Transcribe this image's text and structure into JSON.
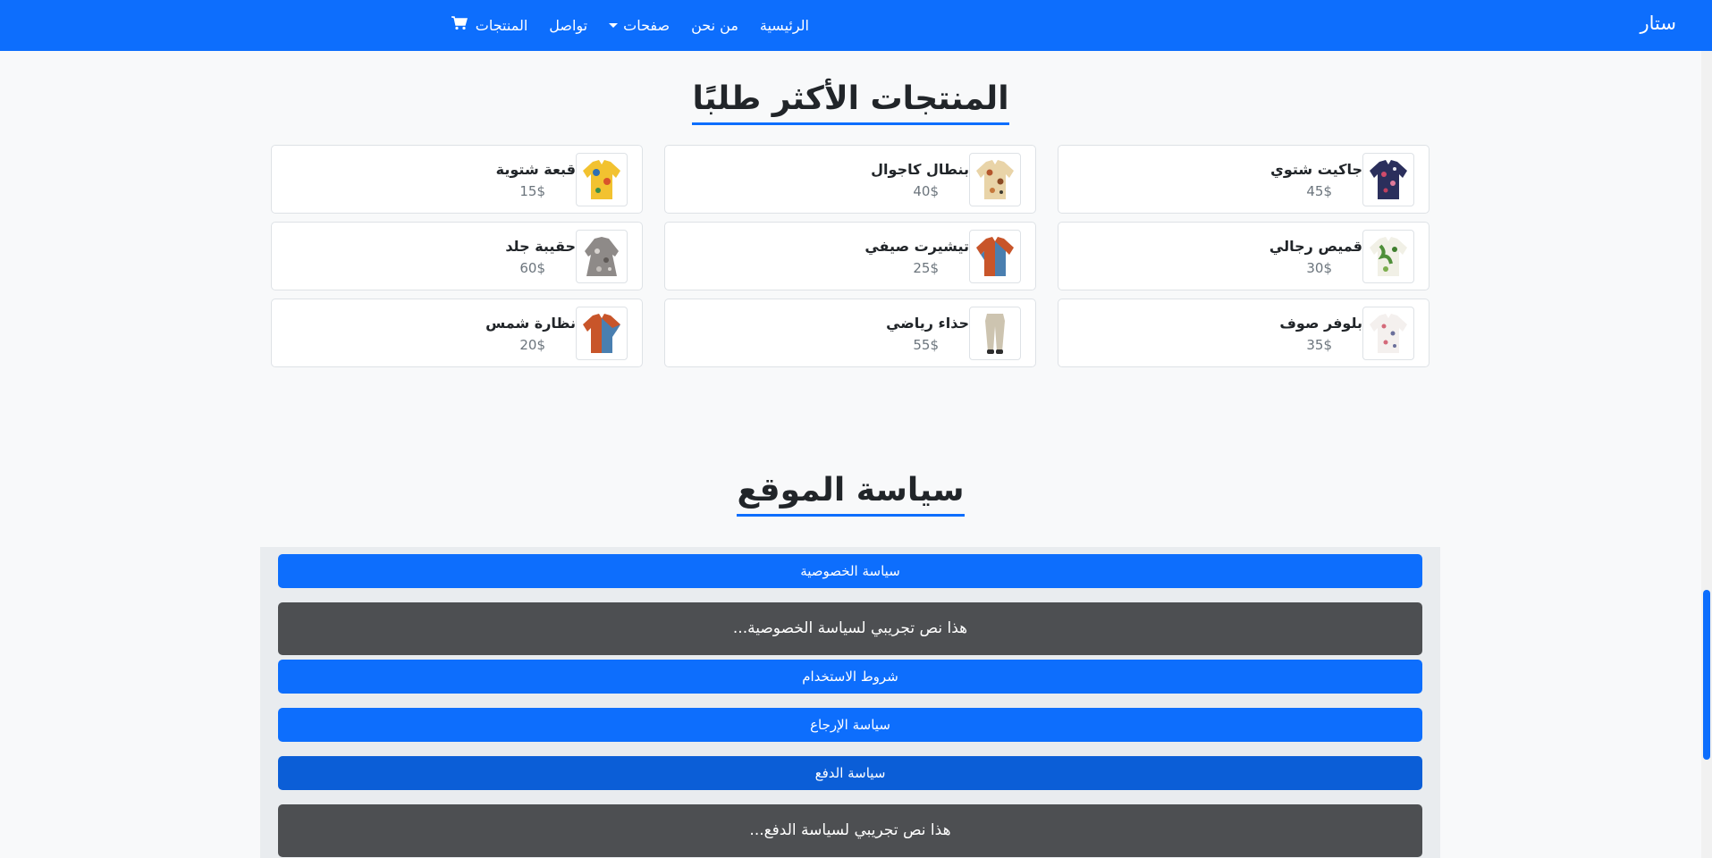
{
  "navbar": {
    "brand": "ستار",
    "links": {
      "home": "الرئيسية",
      "about": "من نحن",
      "pages": "صفحات",
      "contact": "تواصل",
      "products": "المنتجات"
    },
    "cart_icon": "shopping-cart-icon",
    "color": "#0d6efd"
  },
  "best_sellers": {
    "title": "المنتجات الأكثر طلبًا",
    "products": [
      {
        "name": "جاكيت شتوي",
        "price": "45$"
      },
      {
        "name": "بنطال كاجوال",
        "price": "40$"
      },
      {
        "name": "قبعة شتوية",
        "price": "15$"
      },
      {
        "name": "قميص رجالي",
        "price": "30$"
      },
      {
        "name": "تيشيرت صيفي",
        "price": "25$"
      },
      {
        "name": "حقيبة جلد",
        "price": "60$"
      },
      {
        "name": "بلوفر صوف",
        "price": "35$"
      },
      {
        "name": "حذاء رياضي",
        "price": "55$"
      },
      {
        "name": "نظارة شمس",
        "price": "20$"
      }
    ]
  },
  "policy": {
    "title": "سياسة الموقع",
    "privacy_label": "سياسة الخصوصية",
    "privacy_text": "هذا نص تجريبي لسياسة الخصوصية...",
    "terms_label": "شروط الاستخدام",
    "refund_label": "سياسة الإرجاع",
    "payment_label": "سياسة الدفع",
    "payment_text": "هذا نص تجريبي لسياسة الدفع..."
  }
}
